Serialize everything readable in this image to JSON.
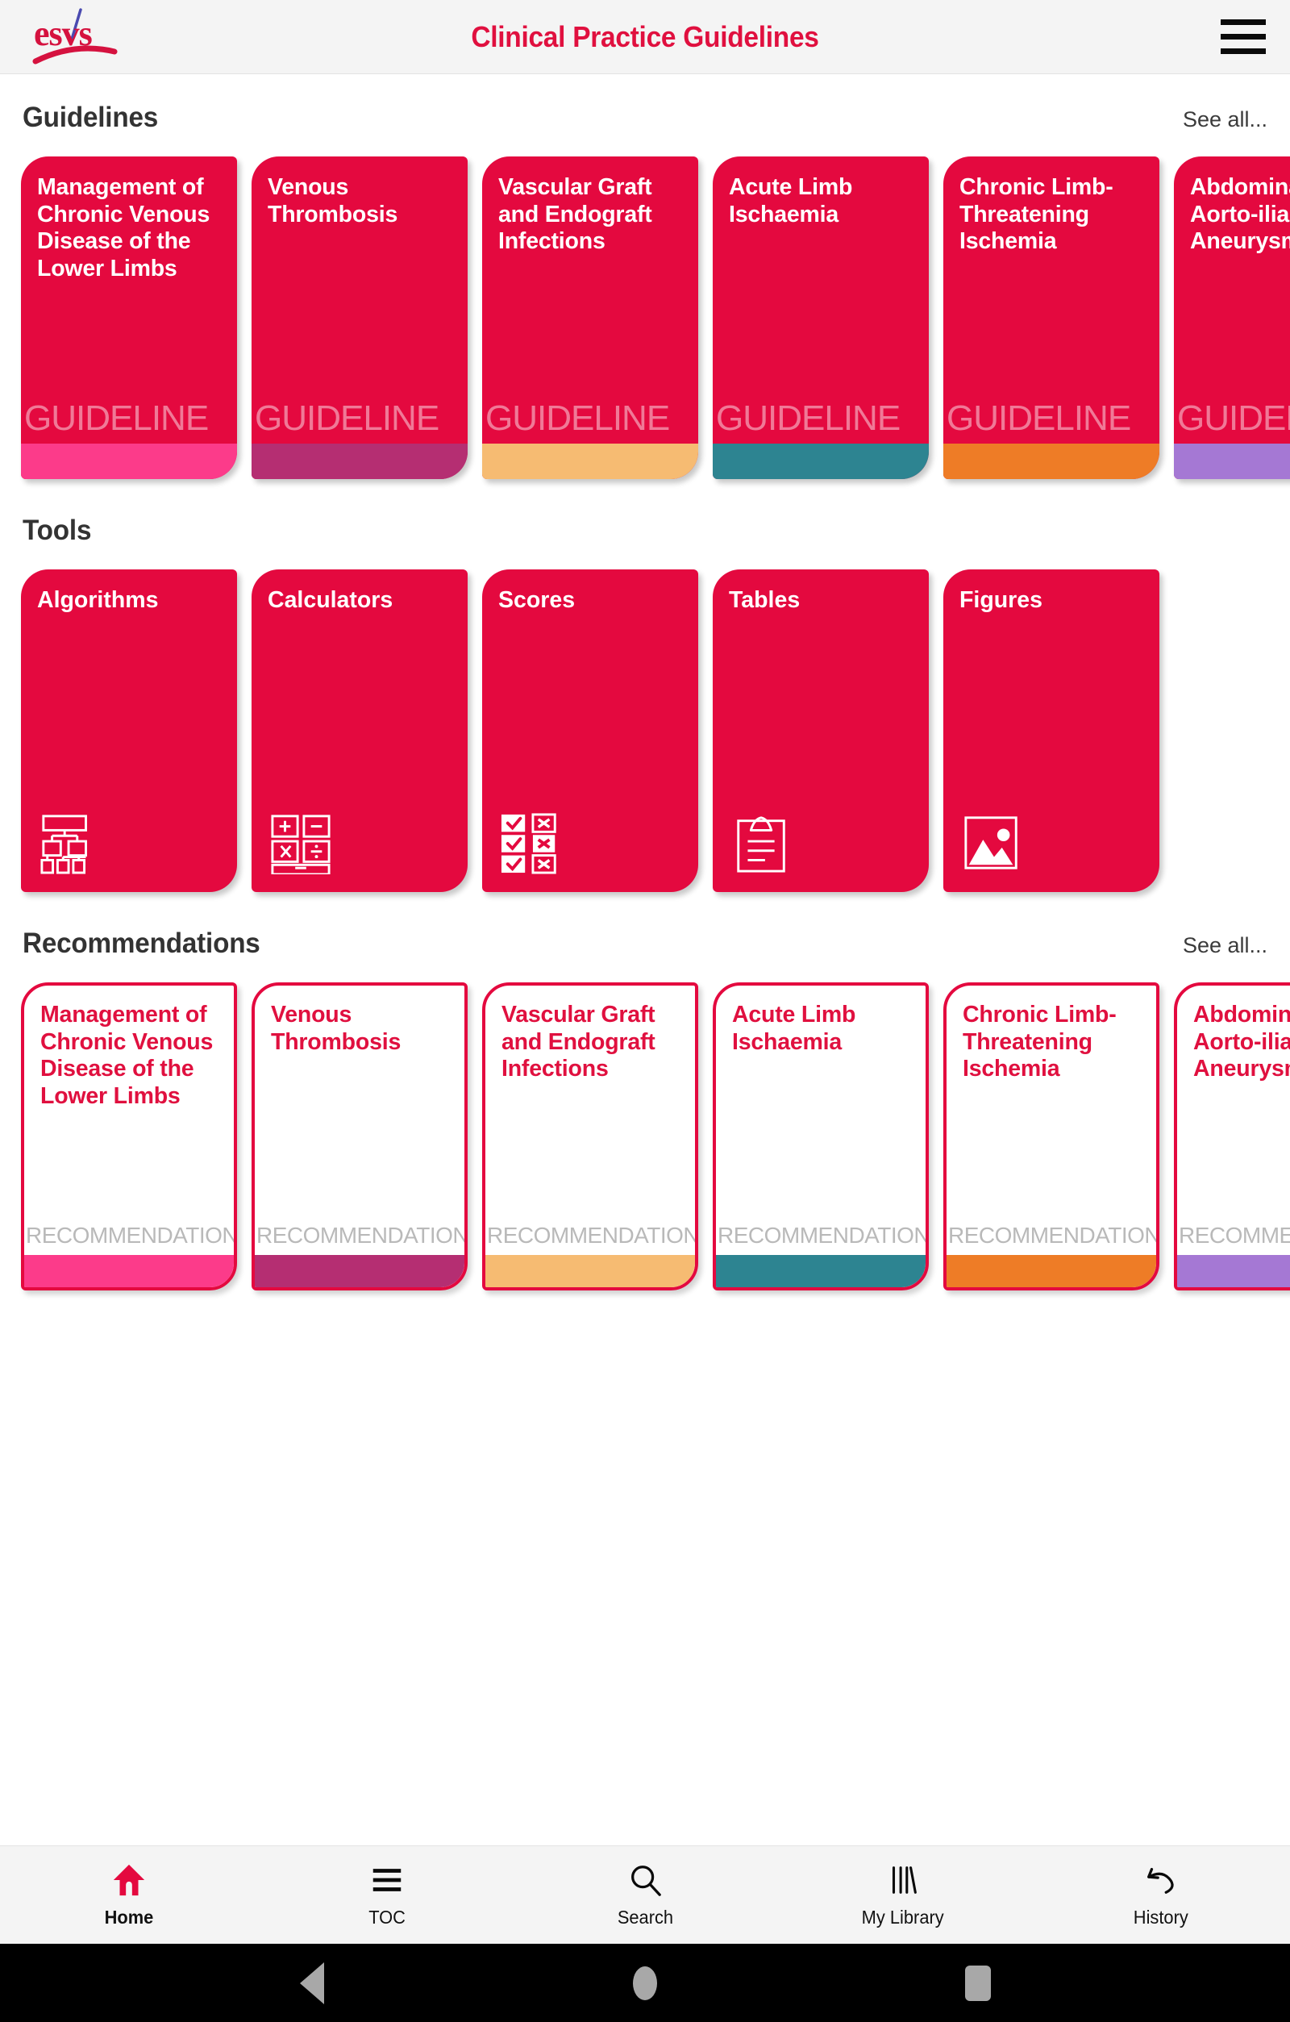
{
  "app": {
    "logo_text": "esvs",
    "title": "Clinical Practice Guidelines",
    "menu_icon": "hamburger-menu-icon"
  },
  "colors": {
    "brand_crimson": "#e0103f",
    "card_red": "#e4093f",
    "header_bg": "#f4f4f4",
    "section_title": "#333333"
  },
  "sections": {
    "guidelines": {
      "title": "Guidelines",
      "see_all": "See all...",
      "watermark": "GUIDELINE",
      "cards": [
        {
          "title": "Management of Chronic Venous Disease of the Lower Limbs",
          "strip_color": "#fc3b8a"
        },
        {
          "title": "Venous Thrombosis",
          "strip_color": "#b52e72"
        },
        {
          "title": "Vascular Graft and Endograft Infections",
          "strip_color": "#f6bb72"
        },
        {
          "title": "Acute Limb Ischaemia",
          "strip_color": "#2d8491"
        },
        {
          "title": "Chronic Limb-Threatening Ischemia",
          "strip_color": "#ee7c26"
        },
        {
          "title": "Abdominal Aorto-iliac Artery Aneurysms",
          "strip_color": "#a578d4"
        }
      ]
    },
    "tools": {
      "title": "Tools",
      "cards": [
        {
          "title": "Algorithms",
          "icon": "flowchart-icon"
        },
        {
          "title": "Calculators",
          "icon": "calculator-icon"
        },
        {
          "title": "Scores",
          "icon": "checklist-icon"
        },
        {
          "title": "Tables",
          "icon": "clipboard-icon"
        },
        {
          "title": "Figures",
          "icon": "image-icon"
        }
      ]
    },
    "recommendations": {
      "title": "Recommendations",
      "see_all": "See all...",
      "watermark": "RECOMMENDATIONS",
      "cards": [
        {
          "title": "Management of Chronic Venous Disease of the Lower Limbs",
          "strip_color": "#fc3b8a"
        },
        {
          "title": "Venous Thrombosis",
          "strip_color": "#b52e72"
        },
        {
          "title": "Vascular Graft and Endograft Infections",
          "strip_color": "#f6bb72"
        },
        {
          "title": "Acute Limb Ischaemia",
          "strip_color": "#2d8491"
        },
        {
          "title": "Chronic Limb-Threatening Ischemia",
          "strip_color": "#ee7c26"
        },
        {
          "title": "Abdominal Aorto-iliac Artery Aneurysms",
          "strip_color": "#a578d4"
        }
      ]
    }
  },
  "bottom_nav": {
    "items": [
      {
        "label": "Home",
        "icon": "home-icon",
        "active": true
      },
      {
        "label": "TOC",
        "icon": "list-icon",
        "active": false
      },
      {
        "label": "Search",
        "icon": "search-icon",
        "active": false
      },
      {
        "label": "My Library",
        "icon": "books-icon",
        "active": false
      },
      {
        "label": "History",
        "icon": "undo-arrow-icon",
        "active": false
      }
    ]
  },
  "system_nav": {
    "back": "back-triangle-icon",
    "home": "home-circle-icon",
    "recents": "recents-square-icon"
  }
}
